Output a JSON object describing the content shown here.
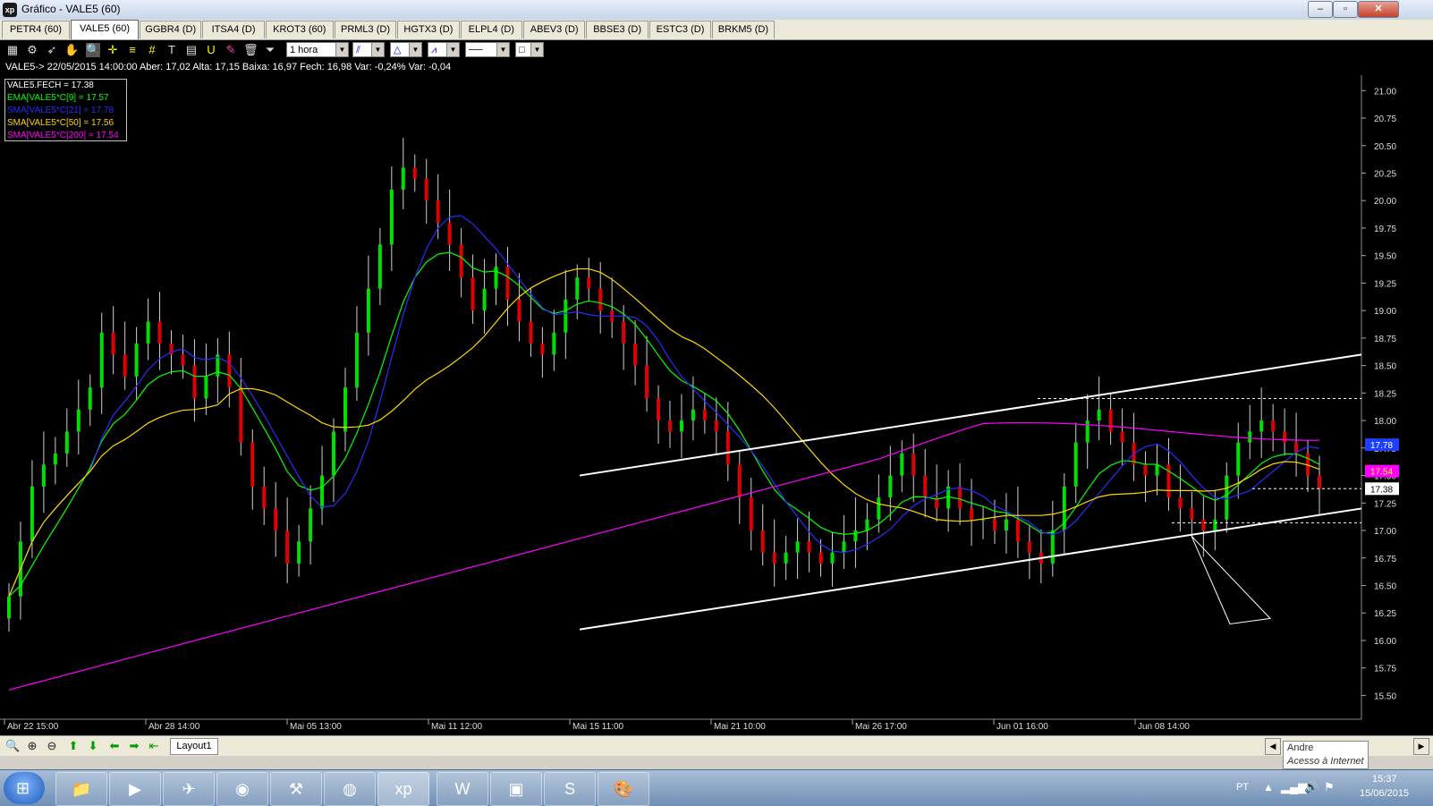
{
  "window": {
    "title": "Gráfico - VALE5 (60)",
    "logo": "xp",
    "min": "–",
    "max": "▫",
    "close": "✕"
  },
  "tabs": [
    "PETR4 (60)",
    "VALE5 (60)",
    "GGBR4 (D)",
    "ITSA4 (D)",
    "KROT3 (60)",
    "PRML3 (D)",
    "HGTX3 (D)",
    "ELPL4 (D)",
    "ABEV3 (D)",
    "BBSE3 (D)",
    "ESTC3 (D)",
    "BRKM5 (D)"
  ],
  "toolbar": {
    "timeframe": "1 hora",
    "timeframe_options": [
      "1 hora"
    ]
  },
  "info_line": "VALE5-> 22/05/2015 14:00:00 Aber: 17,02 Alta: 17,15 Baixa: 16,97 Fech: 16,98 Var: -0,24% Var: -0,04",
  "legend": [
    {
      "label": "VALE5.FECH = 17.38",
      "color": "#ffffff"
    },
    {
      "label": "EMA[VALE5*C[9] = 17.57",
      "color": "#00ff00"
    },
    {
      "label": "SMA[VALE5*C[21] = 17.78",
      "color": "#2b2bff"
    },
    {
      "label": "SMA[VALE5*C[50] = 17.56",
      "color": "#ffd700"
    },
    {
      "label": "SMA[VALE5*C[200] = 17.54",
      "color": "#ff00ff"
    }
  ],
  "chart_data": {
    "type": "candlestick",
    "symbol": "VALE5",
    "ylim": [
      15.3,
      21.1
    ],
    "y_ticks": [
      "21.00",
      "20.75",
      "20.50",
      "20.25",
      "20.00",
      "19.75",
      "19.50",
      "19.25",
      "19.00",
      "18.75",
      "18.50",
      "18.25",
      "18.00",
      "17.75",
      "17.50",
      "17.25",
      "17.00",
      "16.75",
      "16.50",
      "16.25",
      "16.00",
      "15.75",
      "15.50"
    ],
    "x_labels": [
      "Abr 22 15:00",
      "Abr 28 14:00",
      "Mai 05 13:00",
      "Mai 11 12:00",
      "Mai 15 11:00",
      "Mai 21 10:00",
      "Mai 26 17:00",
      "Jun 01 16:00",
      "Jun 08 14:00"
    ],
    "price_tags": [
      {
        "value": "17.78",
        "color": "#1f3fff",
        "text_color": "#ffffff"
      },
      {
        "value": "17.54",
        "color": "#ff00ff",
        "text_color": "#ffff00"
      },
      {
        "value": "17.38",
        "color": "#ffffff",
        "text_color": "#000000"
      }
    ],
    "closes": [
      16.4,
      16.9,
      17.4,
      17.6,
      17.7,
      17.9,
      18.1,
      18.3,
      18.8,
      18.6,
      18.4,
      18.7,
      18.9,
      18.7,
      18.6,
      18.5,
      18.2,
      18.4,
      18.6,
      18.3,
      17.8,
      17.4,
      17.2,
      17.0,
      16.7,
      16.9,
      17.2,
      17.5,
      17.9,
      18.3,
      18.8,
      19.2,
      19.6,
      20.1,
      20.3,
      20.2,
      20.0,
      19.8,
      19.6,
      19.3,
      19.0,
      19.2,
      19.4,
      19.1,
      18.9,
      18.7,
      18.6,
      18.8,
      19.1,
      19.3,
      19.2,
      19.0,
      18.9,
      18.7,
      18.5,
      18.2,
      18.0,
      17.9,
      18.0,
      18.1,
      18.0,
      17.9,
      17.6,
      17.3,
      17.0,
      16.8,
      16.7,
      16.8,
      16.9,
      16.8,
      16.7,
      16.8,
      16.9,
      17.0,
      17.1,
      17.3,
      17.5,
      17.7,
      17.5,
      17.3,
      17.2,
      17.4,
      17.2,
      17.1,
      17.1,
      17.0,
      17.1,
      16.9,
      16.8,
      16.7,
      17.0,
      17.4,
      17.8,
      18.0,
      18.1,
      17.9,
      17.8,
      17.6,
      17.5,
      17.6,
      17.3,
      17.2,
      17.1,
      17.0,
      17.1,
      17.5,
      17.8,
      17.9,
      18.0,
      17.9,
      17.8,
      17.7,
      17.5,
      17.38
    ],
    "annotation": "trend channel lines and dashed support/resistance levels"
  },
  "bottombar": {
    "layout_tab": "Layout1",
    "tooltip_name": "Andre",
    "tooltip_status": "Acesso à Internet"
  },
  "taskbar": {
    "lang": "PT",
    "time": "15:37",
    "date": "15/06/2015"
  }
}
